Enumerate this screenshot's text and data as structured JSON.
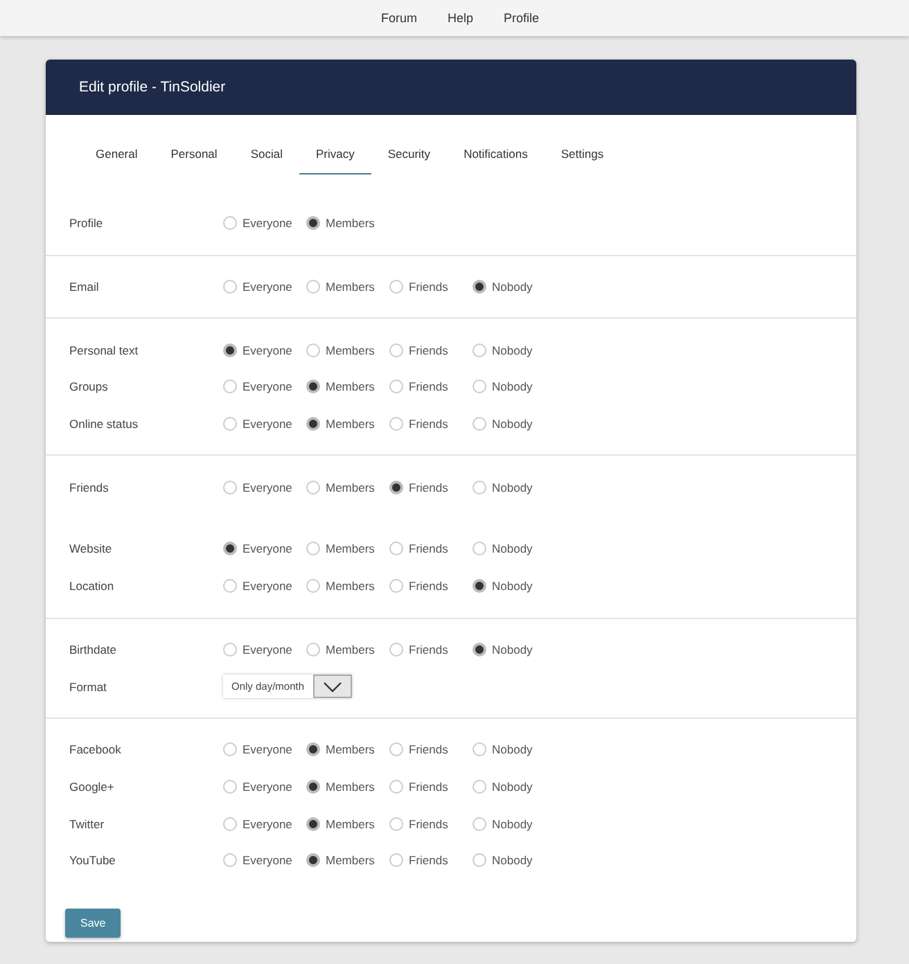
{
  "nav": [
    "Forum",
    "Help",
    "Profile"
  ],
  "title": "Edit profile - TinSoldier",
  "tabs": [
    {
      "label": "General",
      "selected": false
    },
    {
      "label": "Personal",
      "selected": false
    },
    {
      "label": "Social",
      "selected": false
    },
    {
      "label": "Privacy",
      "selected": true
    },
    {
      "label": "Security",
      "selected": false
    },
    {
      "label": "Notifications",
      "selected": false
    },
    {
      "label": "Settings",
      "selected": false
    }
  ],
  "sections": [
    {
      "divider": true,
      "rows": [
        {
          "kind": "radio",
          "label": "Profile",
          "options": [
            {
              "label": "Everyone",
              "selected": false
            },
            {
              "label": "Members",
              "selected": true
            }
          ]
        }
      ]
    },
    {
      "divider": true,
      "rows": [
        {
          "kind": "radio",
          "label": "Email",
          "options": [
            {
              "label": "Everyone",
              "selected": false
            },
            {
              "label": "Members",
              "selected": false
            },
            {
              "label": "Friends",
              "selected": false
            },
            {
              "label": "Nobody",
              "selected": true
            }
          ]
        }
      ]
    },
    {
      "divider": true,
      "rows": [
        {
          "kind": "radio",
          "label": "Personal text",
          "options": [
            {
              "label": "Everyone",
              "selected": true
            },
            {
              "label": "Members",
              "selected": false
            },
            {
              "label": "Friends",
              "selected": false
            },
            {
              "label": "Nobody",
              "selected": false
            }
          ]
        },
        {
          "kind": "radio",
          "label": "Groups",
          "options": [
            {
              "label": "Everyone",
              "selected": false
            },
            {
              "label": "Members",
              "selected": true
            },
            {
              "label": "Friends",
              "selected": false
            },
            {
              "label": "Nobody",
              "selected": false
            }
          ]
        },
        {
          "kind": "radio",
          "label": "Online status",
          "options": [
            {
              "label": "Everyone",
              "selected": false
            },
            {
              "label": "Members",
              "selected": true
            },
            {
              "label": "Friends",
              "selected": false
            },
            {
              "label": "Nobody",
              "selected": false
            }
          ]
        }
      ]
    },
    {
      "divider": false,
      "rows": [
        {
          "kind": "radio",
          "label": "Friends",
          "options": [
            {
              "label": "Everyone",
              "selected": false
            },
            {
              "label": "Members",
              "selected": false
            },
            {
              "label": "Friends",
              "selected": true
            },
            {
              "label": "Nobody",
              "selected": false
            }
          ]
        }
      ]
    },
    {
      "divider": true,
      "rows": [
        {
          "kind": "radio",
          "label": "Website",
          "options": [
            {
              "label": "Everyone",
              "selected": true
            },
            {
              "label": "Members",
              "selected": false
            },
            {
              "label": "Friends",
              "selected": false
            },
            {
              "label": "Nobody",
              "selected": false
            }
          ]
        },
        {
          "kind": "radio",
          "label": "Location",
          "options": [
            {
              "label": "Everyone",
              "selected": false
            },
            {
              "label": "Members",
              "selected": false
            },
            {
              "label": "Friends",
              "selected": false
            },
            {
              "label": "Nobody",
              "selected": true
            }
          ]
        }
      ]
    },
    {
      "divider": true,
      "rows": [
        {
          "kind": "radio",
          "label": "Birthdate",
          "options": [
            {
              "label": "Everyone",
              "selected": false
            },
            {
              "label": "Members",
              "selected": false
            },
            {
              "label": "Friends",
              "selected": false
            },
            {
              "label": "Nobody",
              "selected": true
            }
          ]
        },
        {
          "kind": "select",
          "label": "Format",
          "value": "Only day/month"
        }
      ]
    },
    {
      "divider": false,
      "rows": [
        {
          "kind": "radio",
          "label": "Facebook",
          "options": [
            {
              "label": "Everyone",
              "selected": false
            },
            {
              "label": "Members",
              "selected": true
            },
            {
              "label": "Friends",
              "selected": false
            },
            {
              "label": "Nobody",
              "selected": false
            }
          ]
        },
        {
          "kind": "radio",
          "label": "Google+",
          "options": [
            {
              "label": "Everyone",
              "selected": false
            },
            {
              "label": "Members",
              "selected": true
            },
            {
              "label": "Friends",
              "selected": false
            },
            {
              "label": "Nobody",
              "selected": false
            }
          ]
        },
        {
          "kind": "radio",
          "label": "Twitter",
          "options": [
            {
              "label": "Everyone",
              "selected": false
            },
            {
              "label": "Members",
              "selected": true
            },
            {
              "label": "Friends",
              "selected": false
            },
            {
              "label": "Nobody",
              "selected": false
            }
          ]
        },
        {
          "kind": "radio",
          "label": "YouTube",
          "options": [
            {
              "label": "Everyone",
              "selected": false
            },
            {
              "label": "Members",
              "selected": true
            },
            {
              "label": "Friends",
              "selected": false
            },
            {
              "label": "Nobody",
              "selected": false
            }
          ]
        }
      ]
    }
  ],
  "save": "Save"
}
